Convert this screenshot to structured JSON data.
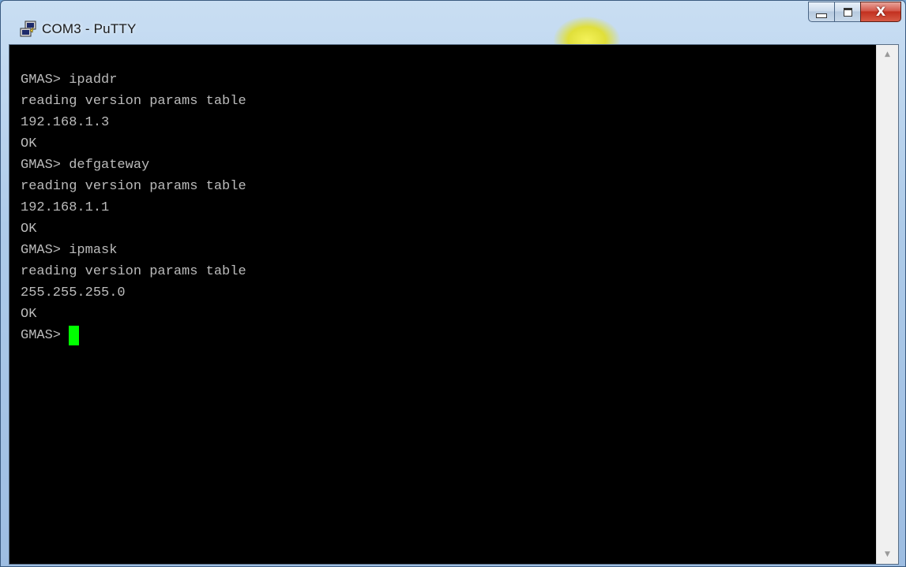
{
  "window": {
    "title": "COM3 - PuTTY",
    "icon": "putty-icon",
    "controls": {
      "minimize_icon": "minimize-icon",
      "maximize_icon": "maximize-icon",
      "close_icon": "close-icon",
      "close_glyph": "X"
    }
  },
  "terminal": {
    "background": "#000000",
    "foreground": "#bbbbbb",
    "cursor_color": "#00ff00",
    "lines": [
      "GMAS> ipaddr",
      "reading version params table",
      "192.168.1.3",
      "OK",
      "GMAS> defgateway",
      "reading version params table",
      "192.168.1.1",
      "OK",
      "GMAS> ipmask",
      "reading version params table",
      "255.255.255.0",
      "OK"
    ],
    "prompt": "GMAS>"
  },
  "scrollbar": {
    "up_arrow": "▲",
    "down_arrow": "▼"
  }
}
